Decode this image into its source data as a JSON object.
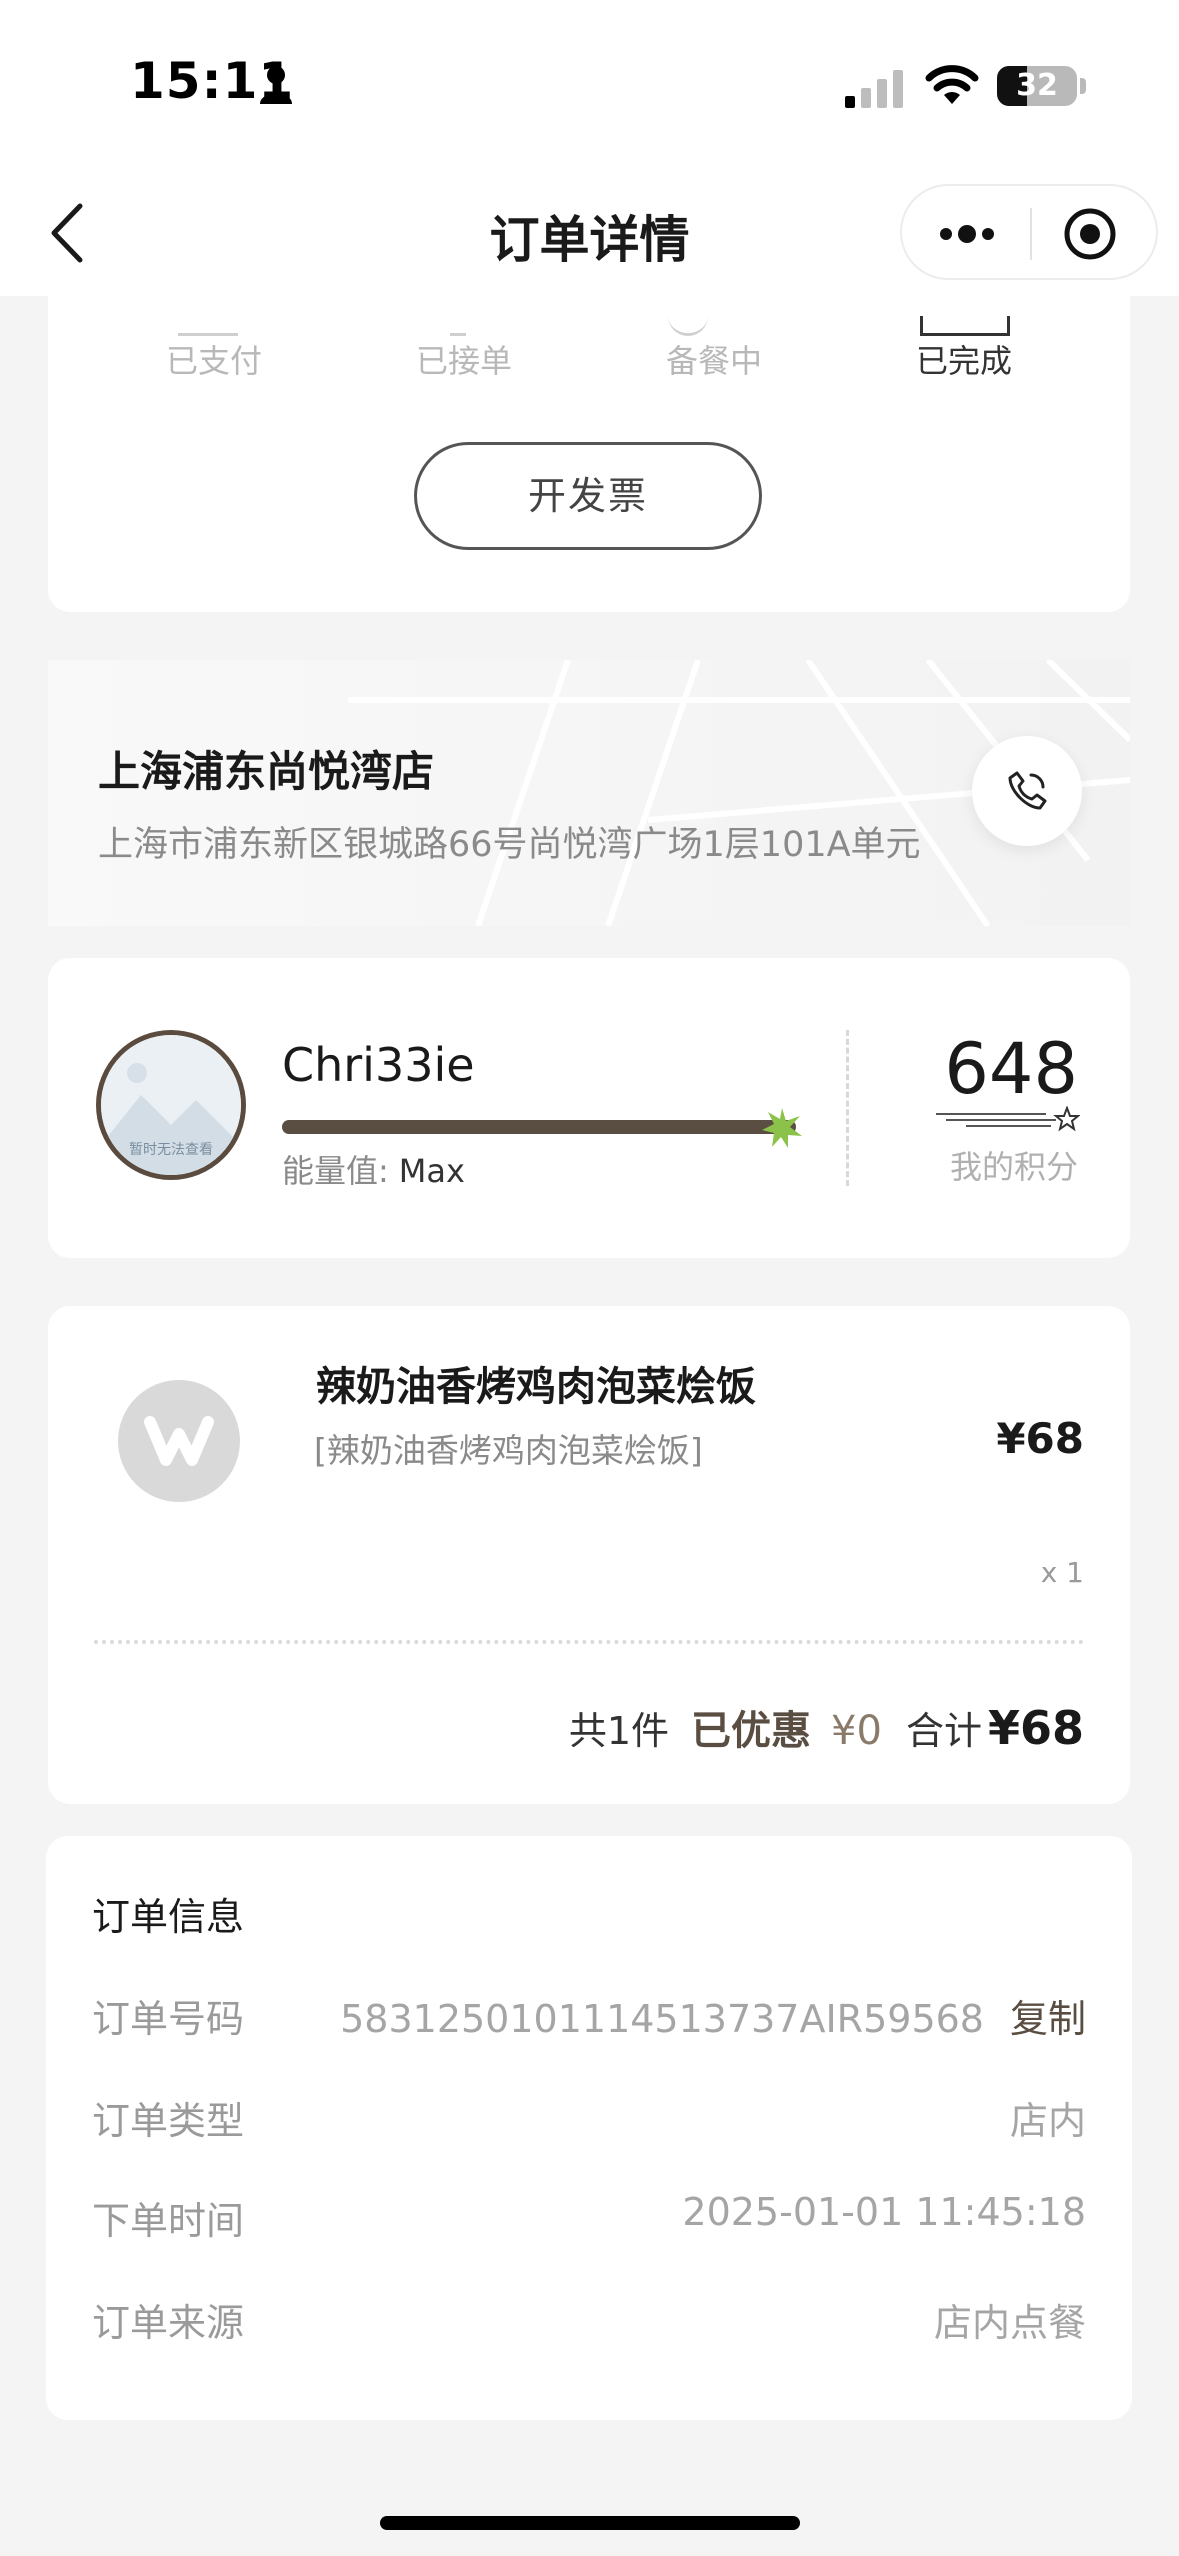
{
  "status_bar": {
    "time": "15:11",
    "battery": "32"
  },
  "nav": {
    "title": "订单详情"
  },
  "progress": {
    "steps": [
      {
        "label": "已支付",
        "done": false
      },
      {
        "label": "已接单",
        "done": false
      },
      {
        "label": "备餐中",
        "done": false
      },
      {
        "label": "已完成",
        "done": true
      }
    ],
    "invoice_button": "开发票"
  },
  "store": {
    "name": "上海浦东尚悦湾店",
    "address": "上海市浦东新区银城路66号尚悦湾广场1层101A单元"
  },
  "member": {
    "username": "Chri33ie",
    "avatar_caption": "暂时无法查看",
    "energy_label": "能量值:",
    "energy_value": "Max",
    "energy_fraction": 1.0,
    "points": "648",
    "points_label": "我的积分"
  },
  "product": {
    "name": "辣奶油香烤鸡肉泡菜烩饭",
    "spec": "[辣奶油香烤鸡肉泡菜烩饭]",
    "price": "¥68",
    "qty": "x 1",
    "summary": {
      "count": "共1件",
      "discount_label": "已优惠",
      "discount_value": "¥0",
      "total_label": "合计",
      "total_value": "¥68"
    }
  },
  "order_info": {
    "title": "订单信息",
    "rows": [
      {
        "key": "订单号码",
        "value": "5831250101114513737AIR59568",
        "action": "复制"
      },
      {
        "key": "订单类型",
        "value": "店内"
      },
      {
        "key": "下单时间",
        "value": "2025-01-01 11:45:18"
      },
      {
        "key": "订单来源",
        "value": "店内点餐"
      }
    ]
  },
  "colors": {
    "accent": "#5a4d42",
    "background": "#f4f4f4",
    "energy_star": "#8bc34a"
  }
}
